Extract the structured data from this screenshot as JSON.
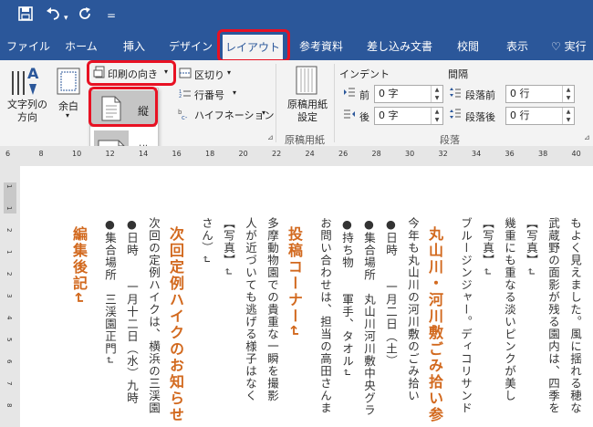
{
  "colors": {
    "brand": "#2b579a",
    "highlight": "#e81123",
    "heading": "#d2691e"
  },
  "quick_access": {
    "save_icon": "save-icon",
    "undo_icon": "undo-icon",
    "redo_icon": "redo-icon",
    "customize": "="
  },
  "tabs": [
    "ファイル",
    "ホーム",
    "挿入",
    "デザイン",
    "レイアウト",
    "参考資料",
    "差し込み文書",
    "校閲",
    "表示"
  ],
  "active_tab": "レイアウト",
  "tell_me": "実行",
  "ribbon": {
    "text_direction": "文字列の\n方向",
    "margins": "余白",
    "orientation": "印刷の向き",
    "breaks": "区切り",
    "line_numbers": "行番号",
    "hyphenation": "ハイフネーション",
    "manuscript": "原稿用紙\n設定",
    "manuscript_group": "原稿用紙",
    "indent_label": "インデント",
    "spacing_label": "間隔",
    "indent_before": "前",
    "indent_after": "後",
    "indent_before_value": "0 字",
    "indent_after_value": "0 字",
    "spacing_before": "段落前",
    "spacing_after": "段落後",
    "spacing_before_value": "0 行",
    "spacing_after_value": "0 行",
    "paragraph_group": "段落"
  },
  "orientation_menu": {
    "portrait": "縦",
    "landscape": "横"
  },
  "ruler_ticks": [
    "6",
    "8",
    "10",
    "12",
    "14",
    "16",
    "18",
    "20",
    "22",
    "24",
    "26",
    "28",
    "30",
    "32",
    "34",
    "36",
    "38",
    "40"
  ],
  "vruler_ticks": [
    "1",
    "1",
    "2",
    "1",
    "2",
    "3",
    "4",
    "5",
    "6",
    "7",
    "8"
  ],
  "document_columns": [
    {
      "text": "もよく見えました。風に揺れる穂な",
      "heading": false
    },
    {
      "text": "武蔵野の面影が残る園内は、四季を",
      "heading": false
    },
    {
      "text": "【写真】↵",
      "heading": false
    },
    {
      "text": "幾重にも重なる淡いピンクが美し",
      "heading": false
    },
    {
      "text": "【写真】↵",
      "heading": false
    },
    {
      "text": "ブルージンジャー。ディコリサンド",
      "heading": false
    },
    {
      "text": "丸山川・河川敷ごみ拾い参",
      "heading": true
    },
    {
      "text": "今年も丸山川の河川敷のごみ拾い",
      "heading": false
    },
    {
      "text": "●日時　　一月二日（土）",
      "heading": false
    },
    {
      "text": "●集合場所　丸山川河川敷中央グラ",
      "heading": false
    },
    {
      "text": "●持ち物　　軍手、タオル↵",
      "heading": false
    },
    {
      "text": "お問い合わせは、担当の高田さんま",
      "heading": false
    },
    {
      "text": "投稿コーナー↵",
      "heading": true
    },
    {
      "text": "多摩動物園での貴重な一瞬を撮影",
      "heading": false
    },
    {
      "text": "人が近づいても逃げる様子はなく",
      "heading": false
    },
    {
      "text": "【写真】↵",
      "heading": false
    },
    {
      "text": "さん）↵",
      "heading": false
    },
    {
      "text": "次回定例ハイクのお知らせ",
      "heading": true
    },
    {
      "text": "次回の定例ハイクは、横浜の三渓園",
      "heading": false
    },
    {
      "text": "●日時　　一月十二日（水）九時",
      "heading": false
    },
    {
      "text": "●集合場所　三渓園正門↵",
      "heading": false
    },
    {
      "text": "編集後記↵",
      "heading": true
    }
  ]
}
